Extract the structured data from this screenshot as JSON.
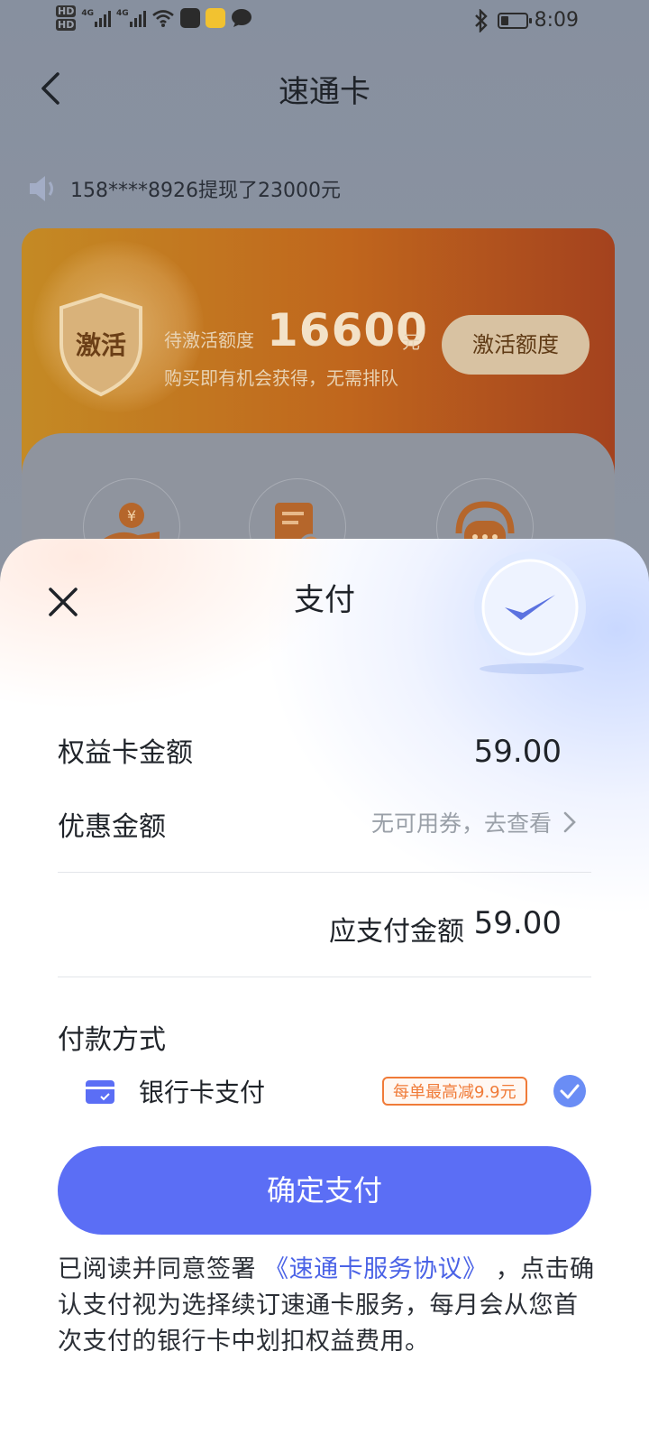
{
  "status_bar": {
    "time": "8:09",
    "hd1": "HD",
    "hd2": "HD",
    "net1": "4G",
    "net2": "4G"
  },
  "nav": {
    "title": "速通卡"
  },
  "notice": {
    "text": "158****8926提现了23000元"
  },
  "promo": {
    "shield_text": "激活",
    "pending_label": "待激活额度",
    "amount": "16600",
    "unit": "元",
    "desc": "购买即有机会获得，无需排队",
    "button_label": "激活额度"
  },
  "sheet": {
    "title": "支付",
    "card_amount_label": "权益卡金额",
    "card_amount_value": "59.00",
    "discount_label": "优惠金额",
    "coupon_text": "无可用券，去查看",
    "due_label": "应支付金额",
    "due_value": "59.00",
    "pay_method_title": "付款方式",
    "bank_label": "银行卡支付",
    "discount_tag": "每单最高减9.9元",
    "confirm_label": "确定支付",
    "agreement_prefix": "已阅读并同意签署",
    "agreement_link": "《速通卡服务协议》",
    "agreement_suffix": "，点击确认支付视为选择续订速通卡服务，每月会从您首次支付的银行卡中划扣权益费用。"
  },
  "colors": {
    "accent": "#5b6ef5",
    "link": "#4a62e6",
    "tag_orange": "#f07b38",
    "check_blue": "#6a8df5"
  }
}
